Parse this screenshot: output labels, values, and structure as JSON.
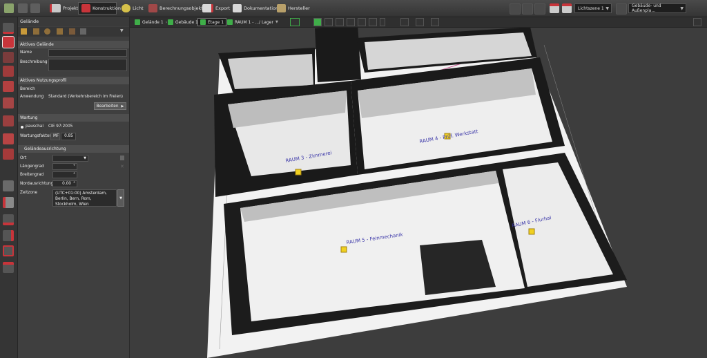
{
  "menu": {
    "tabs": [
      {
        "label": "Projekt"
      },
      {
        "label": "Konstruktion"
      },
      {
        "label": "Licht"
      },
      {
        "label": "Berechnungsobjekte"
      },
      {
        "label": "Export"
      },
      {
        "label": "Dokumentation"
      },
      {
        "label": "Hersteller"
      }
    ],
    "light_zone": "Lichtszene 1",
    "view_select": "Gebäude- und Außenpla..."
  },
  "breadcrumb": {
    "site": "Gelände 1",
    "building": "Gebäude 1",
    "floor": "Etage 1",
    "room": "RAUM 1 - .../ Lager"
  },
  "panel": {
    "title": "Gelände",
    "active_site_header": "Aktives Gelände",
    "name_label": "Name",
    "name_value": "",
    "description_label": "Beschreibung",
    "description_value": "",
    "usage_header": "Aktives Nutzungsprofil",
    "area_label": "Bereich",
    "area_value": "",
    "application_label": "Anwendung",
    "application_value": "Standard (Verkehrsbereich im Freien)",
    "edit_button": "Bearbeiten",
    "maintenance_header": "Wartung",
    "flat_rate_label": "pauschal",
    "flat_rate_value": "CIE 97:2005",
    "maintenance_factor_label": "Wartungsfaktor",
    "mf_label": "MF",
    "mf_value": "0.85",
    "orientation_header": "Geländeausrichtung",
    "location_label": "Ort",
    "location_value": "",
    "longitude_label": "Längengrad",
    "latitude_label": "Breitengrad",
    "north_label": "Nordausrichtung",
    "north_value": "0.00",
    "timezone_label": "Zeitzone",
    "timezone_value": "(UTC+01:00) Amsterdam, Berlin, Bern, Rom, Stockholm, Wien"
  },
  "rooms": {
    "room3": "RAUM 3 - Zimmerei",
    "room4": "RAUM 4 - Prüf. Werkstatt",
    "room5": "RAUM 5 - Feinmechanik",
    "room6": "RAUM 6 - Flurhal"
  },
  "colors": {
    "accent_red": "#c8343a",
    "accent_green": "#3fae49",
    "floor_plan_bg": "#f2f2f2"
  }
}
